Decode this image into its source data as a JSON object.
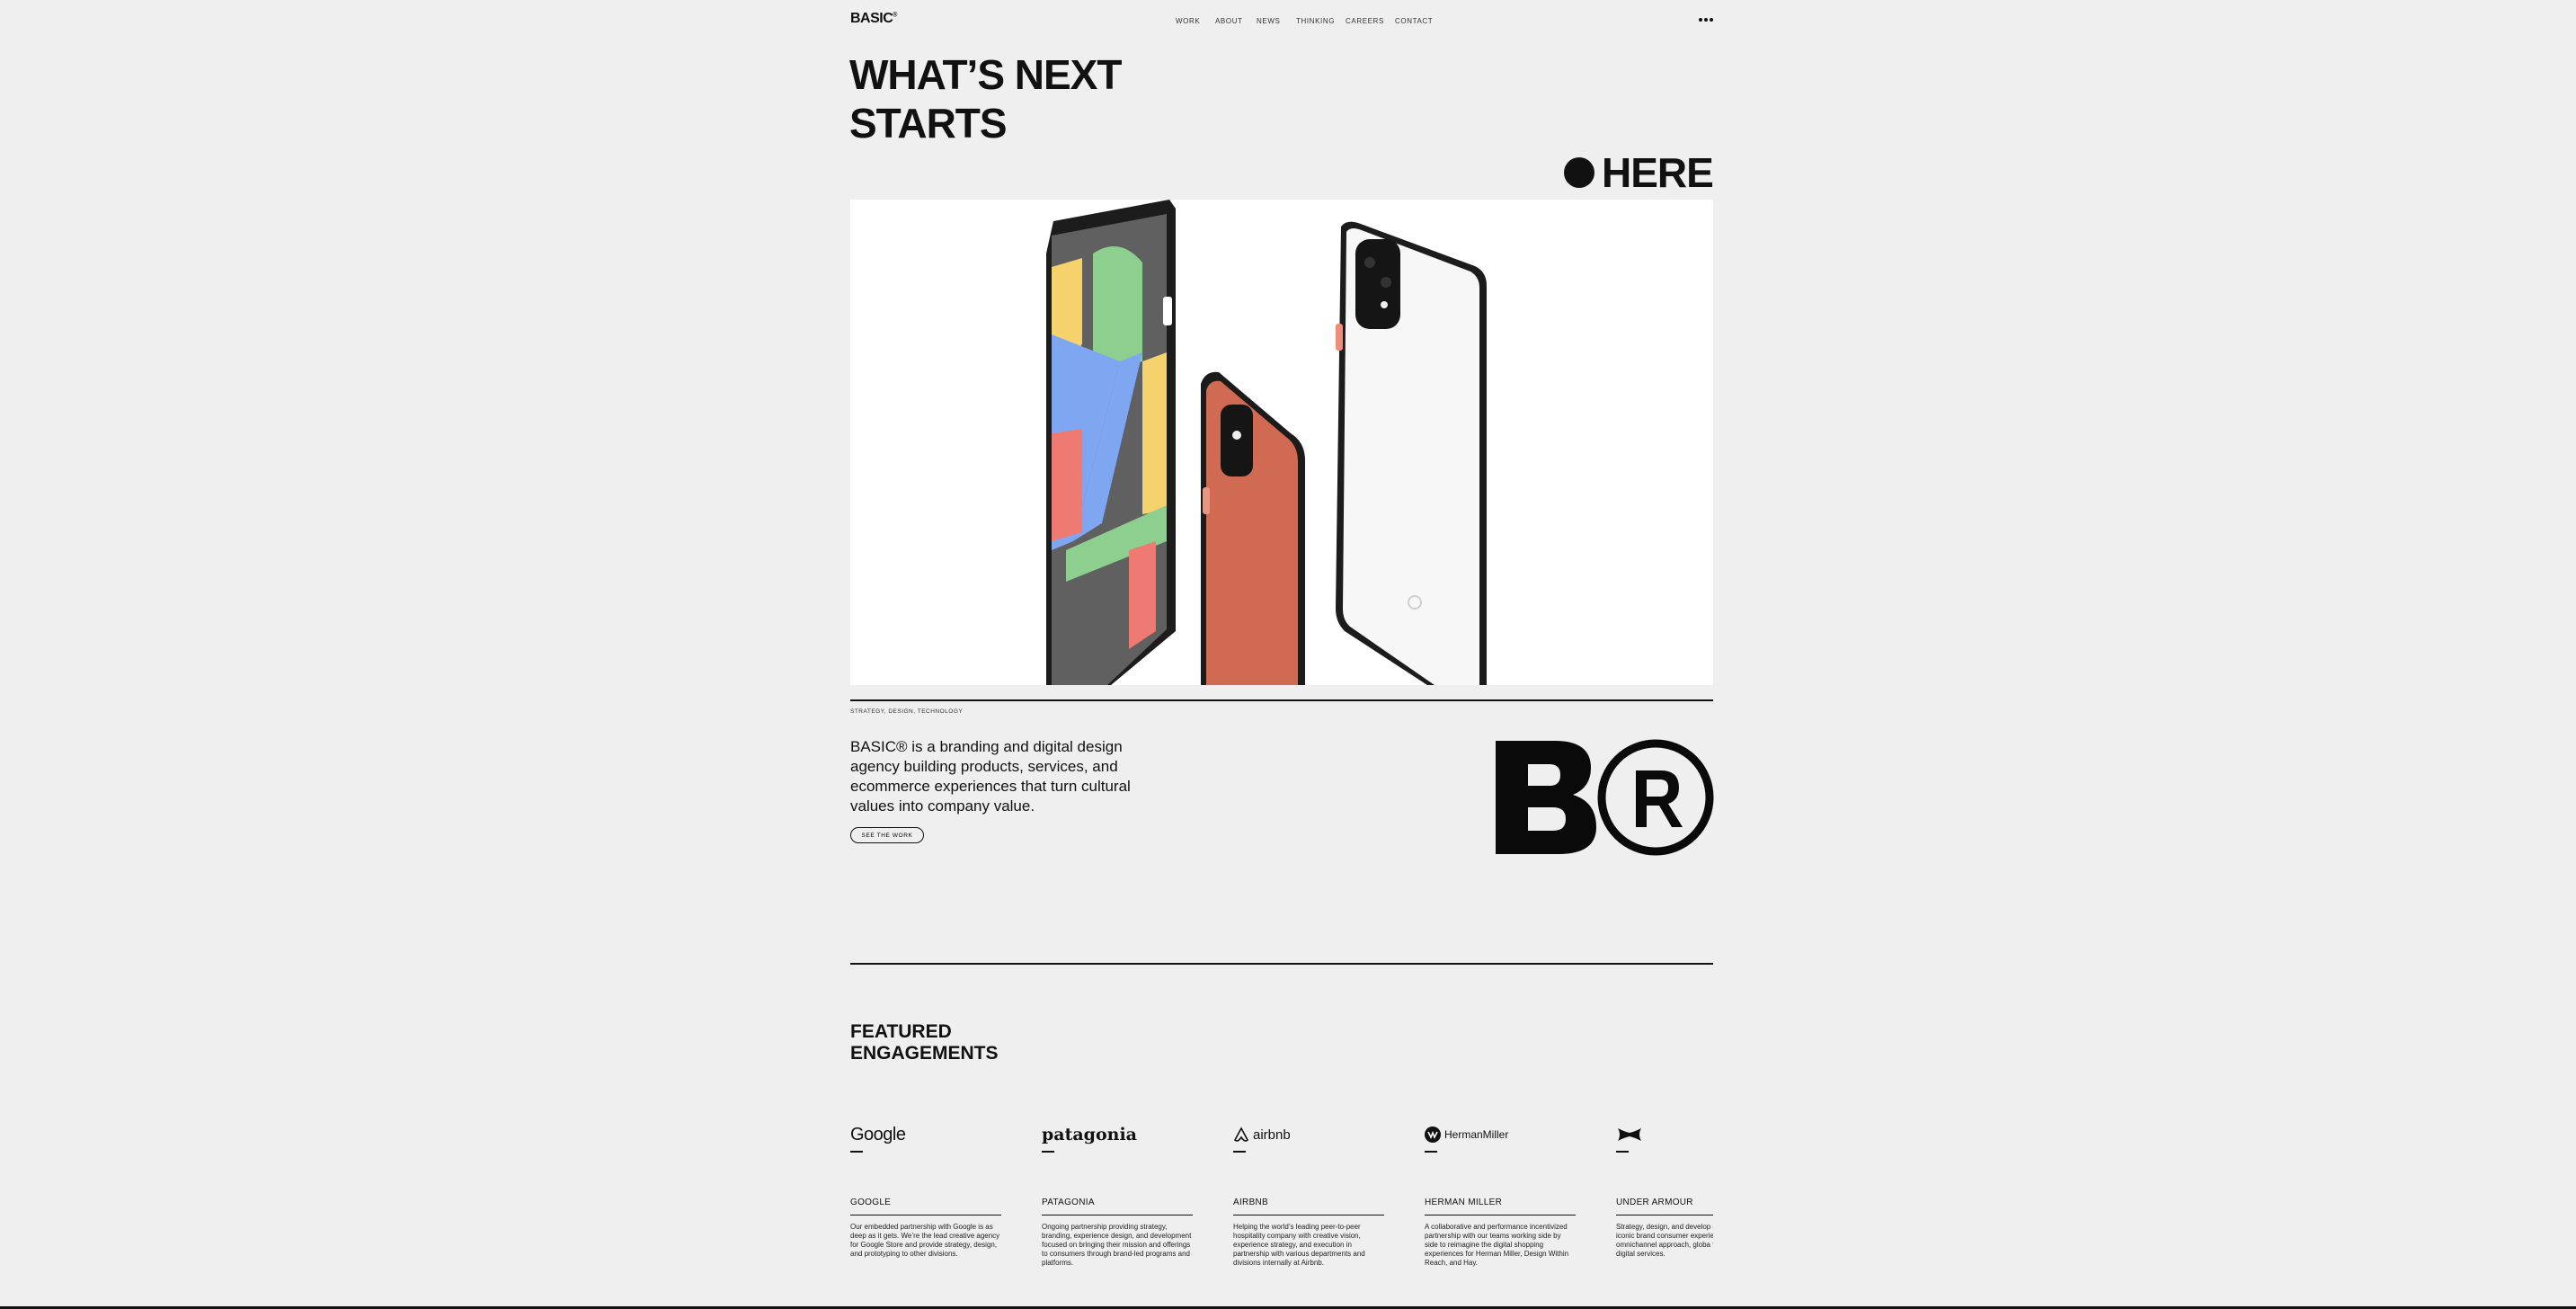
{
  "header": {
    "logo": "BASIC",
    "logo_mark": "®",
    "nav": [
      "WORK",
      "ABOUT",
      "NEWS",
      "THINKING",
      "CAREERS",
      "CONTACT"
    ]
  },
  "hero": {
    "title_line1": "WHAT’S NEXT",
    "title_line2": "STARTS",
    "here": "HERE"
  },
  "intro": {
    "tagline": "STRATEGY, DESIGN, TECHNOLOGY",
    "text": "BASIC® is a branding and digital design agency building products, services, and ecommerce experiences that turn cultural values into company value.",
    "cta": "SEE THE WORK"
  },
  "featured": {
    "title_line1": "FEATURED",
    "title_line2": "ENGAGEMENTS",
    "items": [
      {
        "logo": "Google",
        "name": "GOOGLE",
        "desc": "Our embedded partnership with Google is as deep as it gets. We’re the lead creative agency for Google Store and provide strategy, design, and prototyping to other divisions."
      },
      {
        "logo": "patagonia",
        "name": "PATAGONIA",
        "desc": "Ongoing partnership providing strategy, branding, experience design, and development focused on bringing their mission and offerings to consumers through brand-led programs and platforms."
      },
      {
        "logo": "airbnb",
        "name": "AIRBNB",
        "desc": "Helping the world’s leading peer-to-peer hospitality company with creative vision, experience strategy, and execution in partnership with various departments and divisions internally at Airbnb."
      },
      {
        "logo": "HermanMiller",
        "name": "HERMAN MILLER",
        "desc": "A collaborative and performance incentivized partnership with our teams working side by side to reimagine the digital shopping experiences for Herman Miller, Design Within Reach, and Hay."
      },
      {
        "logo": "",
        "name": "UNDER ARMOUR",
        "desc": "Strategy, design, and develop differentiate the iconic brand consumer experience throug omnichannel approach, globa flagship, and digital services."
      }
    ]
  },
  "colors": {
    "background": "#efefef",
    "text": "#111111",
    "phone_orange": "#d06a52",
    "map_yellow": "#f5d26b",
    "map_green": "#8ccf8e",
    "map_blue": "#7fa6f0",
    "map_red": "#ef7a72"
  }
}
